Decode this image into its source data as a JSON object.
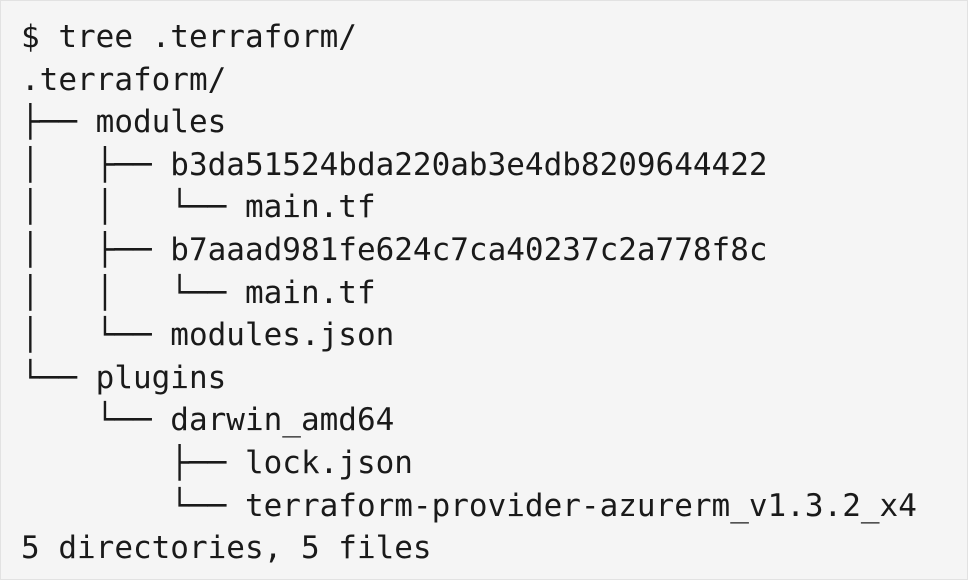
{
  "terminal": {
    "lines": [
      "$ tree .terraform/",
      ".terraform/",
      "├── modules",
      "│   ├── b3da51524bda220ab3e4db8209644422",
      "│   │   └── main.tf",
      "│   ├── b7aaad981fe624c7ca40237c2a778f8c",
      "│   │   └── main.tf",
      "│   └── modules.json",
      "└── plugins",
      "    └── darwin_amd64",
      "        ├── lock.json",
      "        └── terraform-provider-azurerm_v1.3.2_x4",
      "5 directories, 5 files"
    ]
  }
}
